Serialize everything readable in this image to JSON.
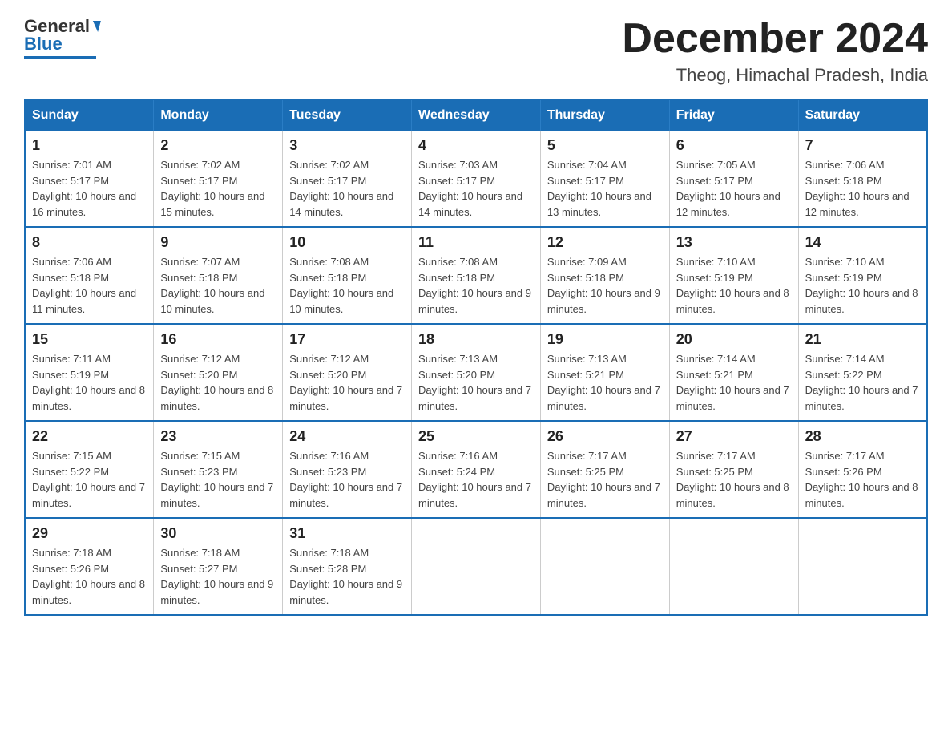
{
  "logo": {
    "general": "General",
    "blue": "Blue"
  },
  "title": {
    "month_year": "December 2024",
    "location": "Theog, Himachal Pradesh, India"
  },
  "days_header": [
    "Sunday",
    "Monday",
    "Tuesday",
    "Wednesday",
    "Thursday",
    "Friday",
    "Saturday"
  ],
  "weeks": [
    [
      {
        "day": "1",
        "sunrise": "7:01 AM",
        "sunset": "5:17 PM",
        "daylight": "10 hours and 16 minutes."
      },
      {
        "day": "2",
        "sunrise": "7:02 AM",
        "sunset": "5:17 PM",
        "daylight": "10 hours and 15 minutes."
      },
      {
        "day": "3",
        "sunrise": "7:02 AM",
        "sunset": "5:17 PM",
        "daylight": "10 hours and 14 minutes."
      },
      {
        "day": "4",
        "sunrise": "7:03 AM",
        "sunset": "5:17 PM",
        "daylight": "10 hours and 14 minutes."
      },
      {
        "day": "5",
        "sunrise": "7:04 AM",
        "sunset": "5:17 PM",
        "daylight": "10 hours and 13 minutes."
      },
      {
        "day": "6",
        "sunrise": "7:05 AM",
        "sunset": "5:17 PM",
        "daylight": "10 hours and 12 minutes."
      },
      {
        "day": "7",
        "sunrise": "7:06 AM",
        "sunset": "5:18 PM",
        "daylight": "10 hours and 12 minutes."
      }
    ],
    [
      {
        "day": "8",
        "sunrise": "7:06 AM",
        "sunset": "5:18 PM",
        "daylight": "10 hours and 11 minutes."
      },
      {
        "day": "9",
        "sunrise": "7:07 AM",
        "sunset": "5:18 PM",
        "daylight": "10 hours and 10 minutes."
      },
      {
        "day": "10",
        "sunrise": "7:08 AM",
        "sunset": "5:18 PM",
        "daylight": "10 hours and 10 minutes."
      },
      {
        "day": "11",
        "sunrise": "7:08 AM",
        "sunset": "5:18 PM",
        "daylight": "10 hours and 9 minutes."
      },
      {
        "day": "12",
        "sunrise": "7:09 AM",
        "sunset": "5:18 PM",
        "daylight": "10 hours and 9 minutes."
      },
      {
        "day": "13",
        "sunrise": "7:10 AM",
        "sunset": "5:19 PM",
        "daylight": "10 hours and 8 minutes."
      },
      {
        "day": "14",
        "sunrise": "7:10 AM",
        "sunset": "5:19 PM",
        "daylight": "10 hours and 8 minutes."
      }
    ],
    [
      {
        "day": "15",
        "sunrise": "7:11 AM",
        "sunset": "5:19 PM",
        "daylight": "10 hours and 8 minutes."
      },
      {
        "day": "16",
        "sunrise": "7:12 AM",
        "sunset": "5:20 PM",
        "daylight": "10 hours and 8 minutes."
      },
      {
        "day": "17",
        "sunrise": "7:12 AM",
        "sunset": "5:20 PM",
        "daylight": "10 hours and 7 minutes."
      },
      {
        "day": "18",
        "sunrise": "7:13 AM",
        "sunset": "5:20 PM",
        "daylight": "10 hours and 7 minutes."
      },
      {
        "day": "19",
        "sunrise": "7:13 AM",
        "sunset": "5:21 PM",
        "daylight": "10 hours and 7 minutes."
      },
      {
        "day": "20",
        "sunrise": "7:14 AM",
        "sunset": "5:21 PM",
        "daylight": "10 hours and 7 minutes."
      },
      {
        "day": "21",
        "sunrise": "7:14 AM",
        "sunset": "5:22 PM",
        "daylight": "10 hours and 7 minutes."
      }
    ],
    [
      {
        "day": "22",
        "sunrise": "7:15 AM",
        "sunset": "5:22 PM",
        "daylight": "10 hours and 7 minutes."
      },
      {
        "day": "23",
        "sunrise": "7:15 AM",
        "sunset": "5:23 PM",
        "daylight": "10 hours and 7 minutes."
      },
      {
        "day": "24",
        "sunrise": "7:16 AM",
        "sunset": "5:23 PM",
        "daylight": "10 hours and 7 minutes."
      },
      {
        "day": "25",
        "sunrise": "7:16 AM",
        "sunset": "5:24 PM",
        "daylight": "10 hours and 7 minutes."
      },
      {
        "day": "26",
        "sunrise": "7:17 AM",
        "sunset": "5:25 PM",
        "daylight": "10 hours and 7 minutes."
      },
      {
        "day": "27",
        "sunrise": "7:17 AM",
        "sunset": "5:25 PM",
        "daylight": "10 hours and 8 minutes."
      },
      {
        "day": "28",
        "sunrise": "7:17 AM",
        "sunset": "5:26 PM",
        "daylight": "10 hours and 8 minutes."
      }
    ],
    [
      {
        "day": "29",
        "sunrise": "7:18 AM",
        "sunset": "5:26 PM",
        "daylight": "10 hours and 8 minutes."
      },
      {
        "day": "30",
        "sunrise": "7:18 AM",
        "sunset": "5:27 PM",
        "daylight": "10 hours and 9 minutes."
      },
      {
        "day": "31",
        "sunrise": "7:18 AM",
        "sunset": "5:28 PM",
        "daylight": "10 hours and 9 minutes."
      },
      null,
      null,
      null,
      null
    ]
  ]
}
